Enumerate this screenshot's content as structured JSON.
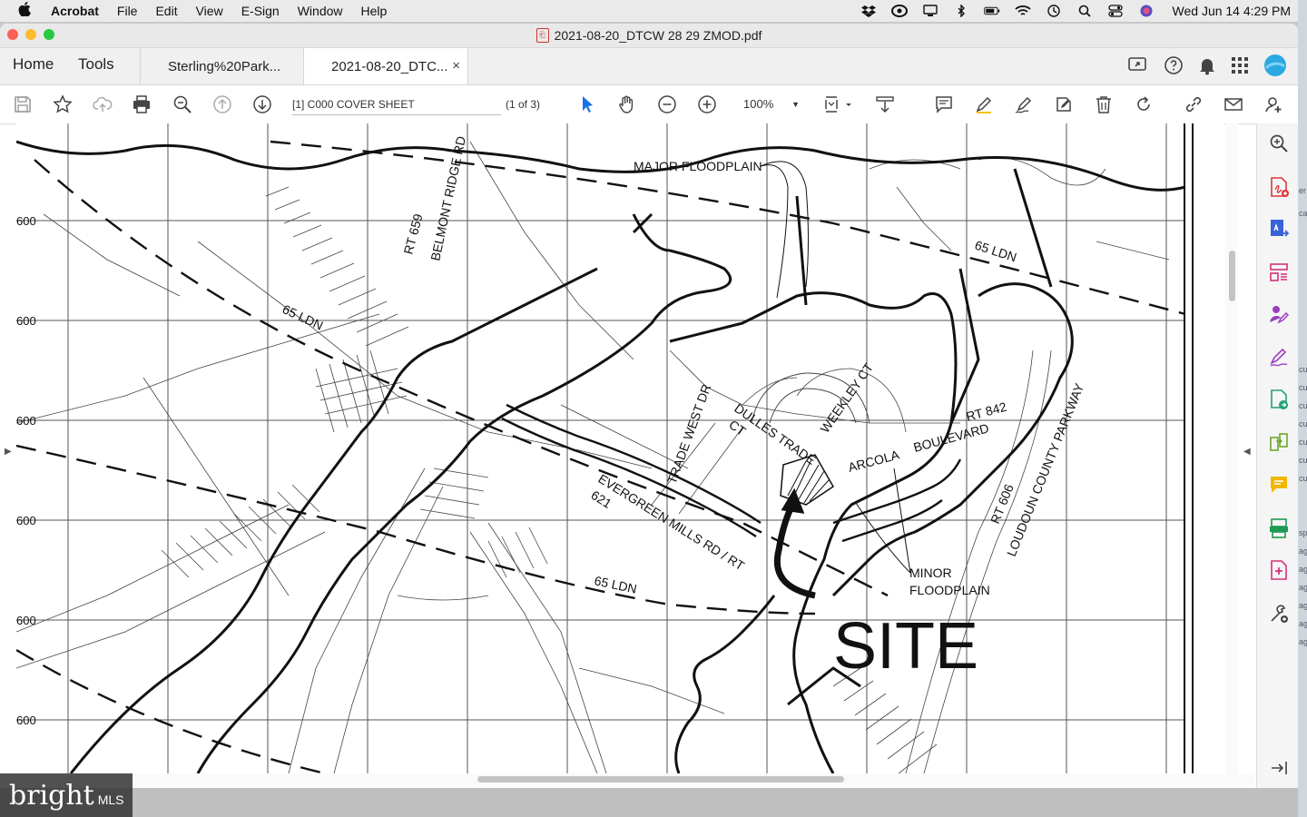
{
  "menubar": {
    "app": "Acrobat",
    "items": [
      "File",
      "Edit",
      "View",
      "E-Sign",
      "Window",
      "Help"
    ],
    "clock": "Wed Jun 14  4:29 PM"
  },
  "window": {
    "title": "2021-08-20_DTCW 28  29 ZMOD.pdf",
    "lights": [
      "#ff5f57",
      "#febc2e",
      "#28c840"
    ]
  },
  "tabs": {
    "home": "Home",
    "tools": "Tools",
    "doc1": "Sterling%20Park...",
    "doc2": "2021-08-20_DTC...",
    "close": "×"
  },
  "toolbar": {
    "page_label": "[1] C000 COVER SHEET",
    "page_count": "(1 of 3)",
    "zoom": "100%"
  },
  "map": {
    "grid_label": "600",
    "major_floodplain": "MAJOR FLOODPLAIN",
    "rt659": "RT 659",
    "belmont": "BELMONT RIDGE RD",
    "ldn": "65 LDN",
    "trade_west": "TRADE WEST DR",
    "dulles_trade": "DULLES TRADE",
    "ct": "CT",
    "weekley": "WEEKLEY CT",
    "rt842": "RT 842",
    "arcola": "ARCOLA",
    "boulevard": "BOULEVARD",
    "evergreen": "EVERGREEN MILLS RD / RT",
    "r621": "621",
    "rt606": "RT 606",
    "loudoun": "LOUDOUN COUNTY PARKWAY",
    "minor1": "MINOR",
    "minor2": "FLOODPLAIN",
    "site": "SITE"
  },
  "watermark": {
    "brand": "bright",
    "suffix": "MLS"
  },
  "edge_fragments": [
    "er",
    "ca",
    "cu",
    "cu",
    "cu",
    "cu",
    "cu",
    "cu",
    "cu",
    "sp",
    "ag",
    "ag",
    "ag",
    "ag",
    "ag",
    "ag"
  ]
}
